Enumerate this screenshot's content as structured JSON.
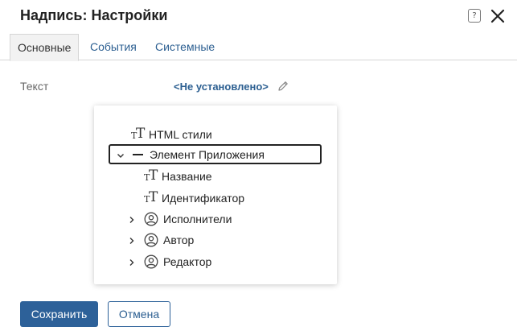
{
  "dialog": {
    "title": "Надпись: Настройки",
    "help_label": "?"
  },
  "tabs": [
    {
      "label": "Основные",
      "active": true
    },
    {
      "label": "События",
      "active": false
    },
    {
      "label": "Системные",
      "active": false
    }
  ],
  "field": {
    "label": "Текст",
    "value": "<Не установлено>"
  },
  "tree": {
    "items": [
      {
        "label": "HTML стили",
        "icon": "text-type-icon"
      },
      {
        "label": "Элемент Приложения",
        "icon": "dash-icon",
        "expanded": true,
        "selected": true
      },
      {
        "label": "Название",
        "icon": "text-type-icon"
      },
      {
        "label": "Идентификатор",
        "icon": "text-type-icon"
      },
      {
        "label": "Исполнители",
        "icon": "user-icon",
        "expandable": true
      },
      {
        "label": "Автор",
        "icon": "user-icon",
        "expandable": true
      },
      {
        "label": "Редактор",
        "icon": "user-icon",
        "expandable": true
      }
    ]
  },
  "footer": {
    "save_label": "Сохранить",
    "cancel_label": "Отмена"
  },
  "colors": {
    "accent": "#2d6199",
    "link": "#2c5f91"
  }
}
